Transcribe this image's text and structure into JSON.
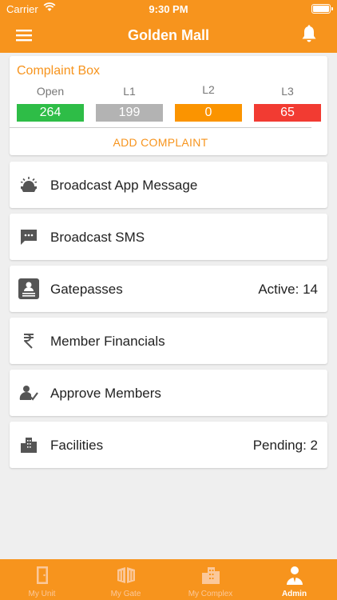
{
  "status_bar": {
    "carrier": "Carrier",
    "time": "9:30 PM"
  },
  "header": {
    "title": "Golden Mall"
  },
  "complaint_box": {
    "title": "Complaint Box",
    "columns": [
      {
        "label": "Open",
        "value": "264",
        "color": "#2ebd47"
      },
      {
        "label": "L1",
        "value": "199",
        "color": "#b3b3b3"
      },
      {
        "label": "L2",
        "value": "0",
        "color": "#fb9400"
      },
      {
        "label": "L3",
        "value": "65",
        "color": "#f23b32"
      }
    ],
    "add_label": "ADD COMPLAINT"
  },
  "menu": [
    {
      "label": "Broadcast App Message",
      "icon": "broadcast-icon",
      "right": ""
    },
    {
      "label": "Broadcast SMS",
      "icon": "sms-icon",
      "right": ""
    },
    {
      "label": "Gatepasses",
      "icon": "gatepass-icon",
      "right": "Active: 14"
    },
    {
      "label": "Member Financials",
      "icon": "rupee-icon",
      "right": ""
    },
    {
      "label": "Approve Members",
      "icon": "approve-members-icon",
      "right": ""
    },
    {
      "label": "Facilities",
      "icon": "facilities-icon",
      "right": "Pending: 2"
    }
  ],
  "tabs": [
    {
      "label": "My Unit",
      "icon": "unit-door-icon",
      "active": false
    },
    {
      "label": "My Gate",
      "icon": "gate-icon",
      "active": false
    },
    {
      "label": "My Complex",
      "icon": "complex-building-icon",
      "active": false
    },
    {
      "label": "Admin",
      "icon": "admin-user-icon",
      "active": true
    }
  ],
  "colors": {
    "brand": "#f7941d",
    "background": "#efefef",
    "icon": "#555555"
  }
}
